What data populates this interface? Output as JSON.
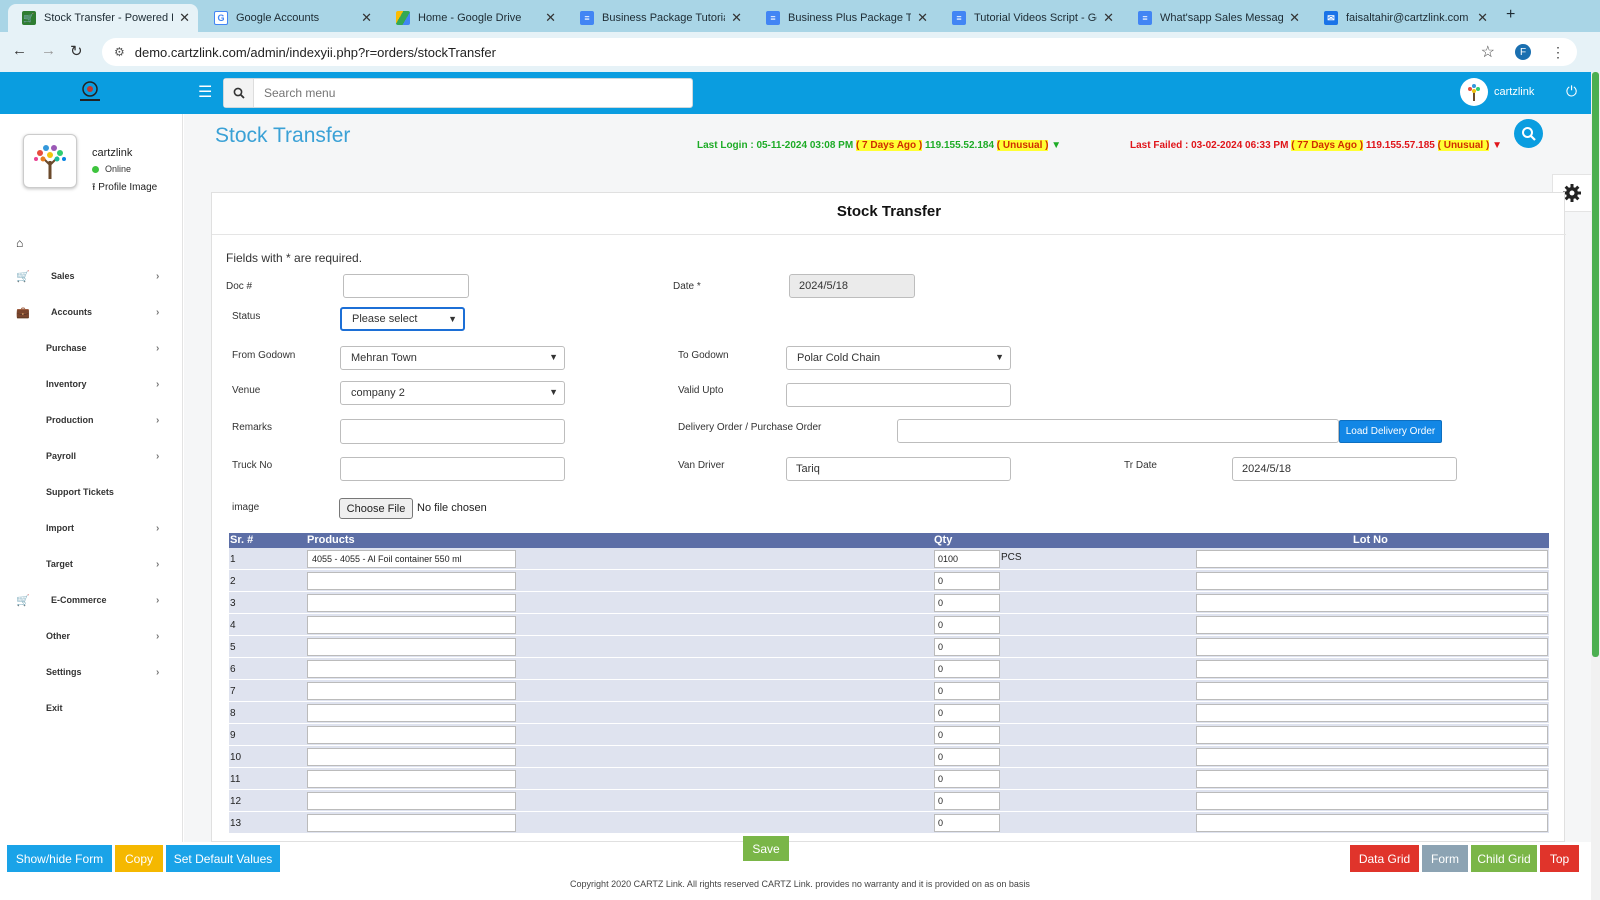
{
  "browser": {
    "tabs": [
      {
        "title": "Stock Transfer - Powered B",
        "active": true,
        "icon": "cart-icon",
        "color": "#2e7d32"
      },
      {
        "title": "Google Accounts",
        "active": false,
        "icon": "google-icon",
        "color": "#4285f4"
      },
      {
        "title": "Home - Google Drive",
        "active": false,
        "icon": "drive-icon",
        "color": "#fbbc04"
      },
      {
        "title": "Business Package Tutorial",
        "active": false,
        "icon": "docs-icon",
        "color": "#4285f4"
      },
      {
        "title": "Business Plus Package Tut",
        "active": false,
        "icon": "docs-icon",
        "color": "#4285f4"
      },
      {
        "title": "Tutorial Videos Script - Go",
        "active": false,
        "icon": "docs-icon",
        "color": "#4285f4"
      },
      {
        "title": "What'sapp Sales Messag",
        "active": false,
        "icon": "docs-icon",
        "color": "#4285f4"
      },
      {
        "title": "faisaltahir@cartzlink.com",
        "active": false,
        "icon": "mail-icon",
        "color": "#1a73e8"
      }
    ],
    "url": "demo.cartzlink.com/admin/indexyii.php?r=orders/stockTransfer",
    "profile_initial": "F"
  },
  "header": {
    "search_placeholder": "Search menu",
    "username": "cartzlink"
  },
  "sidebar": {
    "name": "cartzlink",
    "status": "Online",
    "profile_image_label": "Profile Image",
    "items": [
      {
        "label": "Sales",
        "icon": "cart-icon",
        "has_icon": true,
        "chevron": true
      },
      {
        "label": "Accounts",
        "icon": "briefcase-icon",
        "has_icon": true,
        "chevron": true
      },
      {
        "label": "Purchase",
        "has_icon": false,
        "chevron": true
      },
      {
        "label": "Inventory",
        "has_icon": false,
        "chevron": true
      },
      {
        "label": "Production",
        "has_icon": false,
        "chevron": true
      },
      {
        "label": "Payroll",
        "has_icon": false,
        "chevron": true
      },
      {
        "label": "Support Tickets",
        "has_icon": false,
        "chevron": false
      },
      {
        "label": "Import",
        "has_icon": false,
        "chevron": true
      },
      {
        "label": "Target",
        "has_icon": false,
        "chevron": true
      },
      {
        "label": "E-Commerce",
        "icon": "cart-icon",
        "has_icon": true,
        "chevron": true
      },
      {
        "label": "Other",
        "has_icon": false,
        "chevron": true
      },
      {
        "label": "Settings",
        "has_icon": false,
        "chevron": true
      },
      {
        "label": "Exit",
        "has_icon": false,
        "chevron": false
      }
    ]
  },
  "page": {
    "title": "Stock Transfer",
    "last_login": {
      "prefix": "Last Login : 05-11-2024 03:08 PM",
      "ago": "( 7 Days Ago )",
      "ip": "119.155.52.184",
      "flag": "( Unusual )",
      "arrow": "▼"
    },
    "last_failed": {
      "prefix": "Last Failed : 03-02-2024 06:33 PM",
      "ago": "( 77 Days Ago )",
      "ip": "119.155.57.185",
      "flag": "( Unusual )",
      "arrow": "▼"
    }
  },
  "form": {
    "title": "Stock Transfer",
    "required_note": "Fields with * are required.",
    "doc_label": "Doc #",
    "doc_value": "",
    "date_label": "Date *",
    "date_value": "2024/5/18",
    "status_label": "Status",
    "status_value": "Please select",
    "from_godown_label": "From Godown",
    "from_godown_value": "Mehran Town",
    "to_godown_label": "To Godown",
    "to_godown_value": "Polar Cold Chain",
    "venue_label": "Venue",
    "venue_value": "company 2",
    "valid_upto_label": "Valid Upto",
    "valid_upto_value": "",
    "remarks_label": "Remarks",
    "delivery_order_label": "Delivery Order / Purchase Order",
    "load_delivery_label": "Load Delivery Order",
    "truck_no_label": "Truck No",
    "van_driver_label": "Van Driver",
    "van_driver_value": "Tariq",
    "tr_date_label": "Tr Date",
    "tr_date_value": "2024/5/18",
    "image_label": "image",
    "choose_file_label": "Choose File",
    "no_file_label": "No file chosen"
  },
  "grid": {
    "headers": {
      "sr": "Sr. #",
      "products": "Products",
      "qty": "Qty",
      "lot": "Lot No"
    },
    "rows": [
      {
        "sr": "1",
        "product": "4055 - 4055 - Al Foil container 550 ml",
        "qty": "0100",
        "unit": "PCS"
      },
      {
        "sr": "2",
        "product": "",
        "qty": "0",
        "unit": ""
      },
      {
        "sr": "3",
        "product": "",
        "qty": "0",
        "unit": ""
      },
      {
        "sr": "4",
        "product": "",
        "qty": "0",
        "unit": ""
      },
      {
        "sr": "5",
        "product": "",
        "qty": "0",
        "unit": ""
      },
      {
        "sr": "6",
        "product": "",
        "qty": "0",
        "unit": ""
      },
      {
        "sr": "7",
        "product": "",
        "qty": "0",
        "unit": ""
      },
      {
        "sr": "8",
        "product": "",
        "qty": "0",
        "unit": ""
      },
      {
        "sr": "9",
        "product": "",
        "qty": "0",
        "unit": ""
      },
      {
        "sr": "10",
        "product": "",
        "qty": "0",
        "unit": ""
      },
      {
        "sr": "11",
        "product": "",
        "qty": "0",
        "unit": ""
      },
      {
        "sr": "12",
        "product": "",
        "qty": "0",
        "unit": ""
      },
      {
        "sr": "13",
        "product": "",
        "qty": "0",
        "unit": ""
      }
    ]
  },
  "bottom": {
    "show_hide": "Show/hide Form",
    "copy": "Copy",
    "set_default": "Set Default Values",
    "save": "Save",
    "data_grid": "Data Grid",
    "form": "Form",
    "child_grid": "Child Grid",
    "top": "Top",
    "copyright": "Copyright 2020 CARTZ Link. All rights reserved CARTZ Link. provides no warranty and it is provided on as on basis"
  },
  "colors": {
    "header_blue": "#0a9de0",
    "grid_header": "#5c6ea6",
    "grid_row": "#dfe3ef",
    "btn_blue": "#1aa3e8",
    "btn_yellow": "#f5b800",
    "btn_green": "#7ab648",
    "btn_red": "#e0342b",
    "btn_gray": "#8ca3b3",
    "title_blue": "#3aa1d6"
  }
}
